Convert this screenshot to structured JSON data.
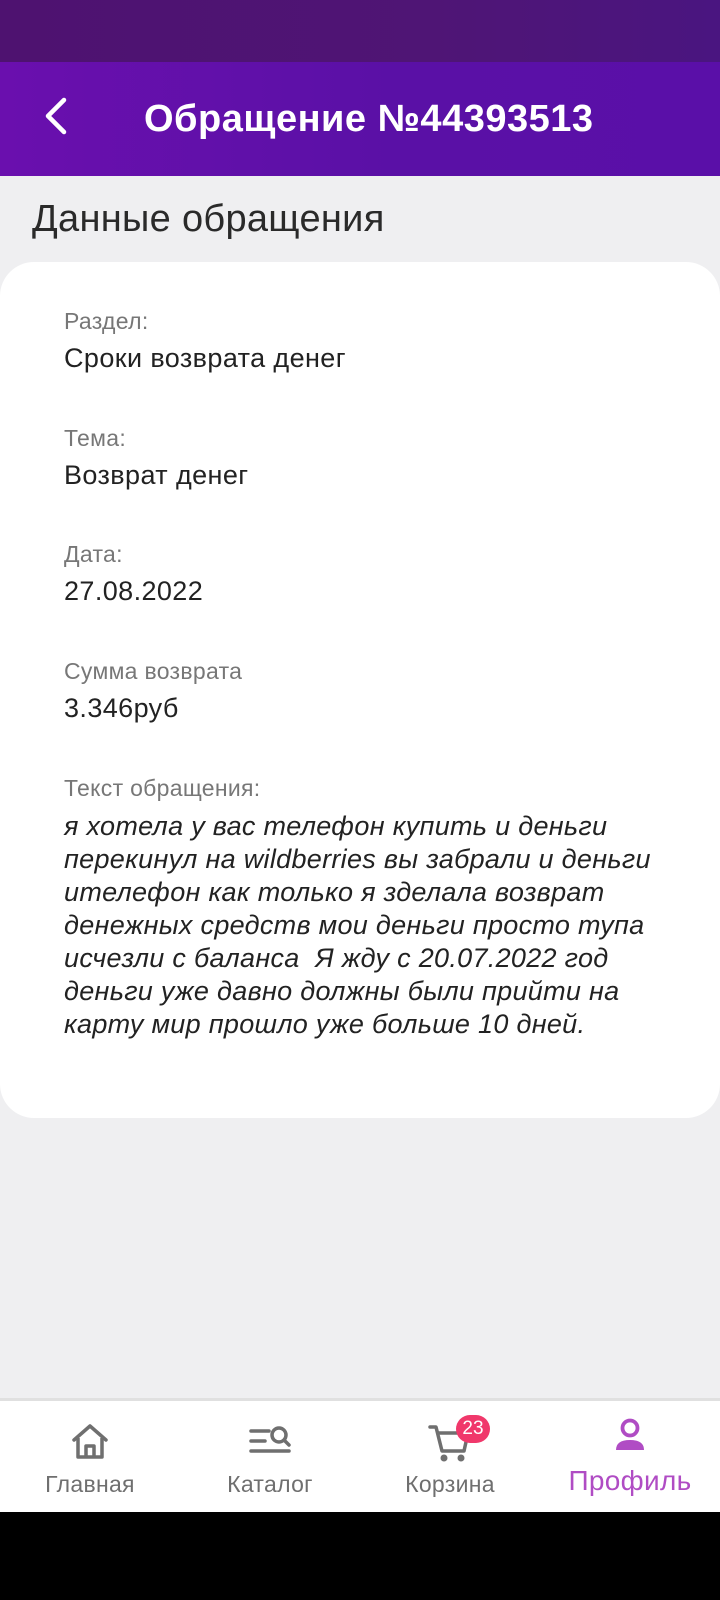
{
  "header": {
    "title": "Обращение №44393513",
    "background_color": "#5c10a7"
  },
  "section_title": "Данные обращения",
  "details": {
    "section": {
      "label": "Раздел:",
      "value": "Сроки возврата денег"
    },
    "topic": {
      "label": "Тема:",
      "value": "Возврат денег"
    },
    "date": {
      "label": "Дата:",
      "value": "27.08.2022"
    },
    "refund": {
      "label": "Сумма возврата",
      "value": "3.346руб"
    },
    "message": {
      "label": "Текст обращения:",
      "value": "я хотела у вас телефон купить и деньги перекинул на wildberries вы забрали и деньги ителефон как только я зделала возврат денежных средств мои деньги просто тупа  исчезли с баланса  Я жду с 20.07.2022 год деньги уже давно должны были прийти на карту мир прошло уже больше 10 дней."
    }
  },
  "nav": {
    "items": [
      {
        "label": "Главная",
        "icon": "home-icon"
      },
      {
        "label": "Каталог",
        "icon": "catalog-search-icon"
      },
      {
        "label": "Корзина",
        "icon": "cart-icon",
        "badge": "23"
      },
      {
        "label": "Профиль",
        "icon": "profile-icon",
        "active": true
      }
    ],
    "active_color": "#b04cc4",
    "badge_color": "#f0386b"
  }
}
